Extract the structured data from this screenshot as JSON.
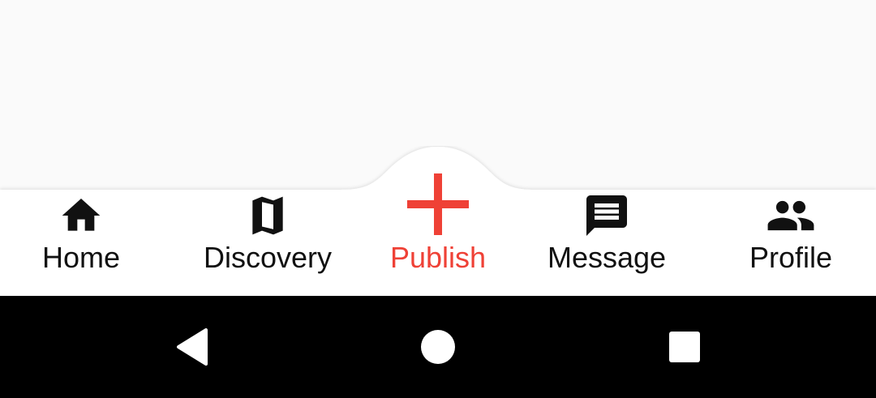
{
  "nav": {
    "items": [
      {
        "label": "Home",
        "icon": "home-icon",
        "active": false
      },
      {
        "label": "Discovery",
        "icon": "map-icon",
        "active": false
      },
      {
        "label": "Publish",
        "icon": "plus-icon",
        "active": true
      },
      {
        "label": "Message",
        "icon": "message-icon",
        "active": false
      },
      {
        "label": "Profile",
        "icon": "people-icon",
        "active": false
      }
    ],
    "accent_color": "#ef4136",
    "text_color": "#111111"
  },
  "system_bar": {
    "buttons": [
      "back-icon",
      "home-circle-icon",
      "recents-icon"
    ],
    "background": "#000000"
  }
}
